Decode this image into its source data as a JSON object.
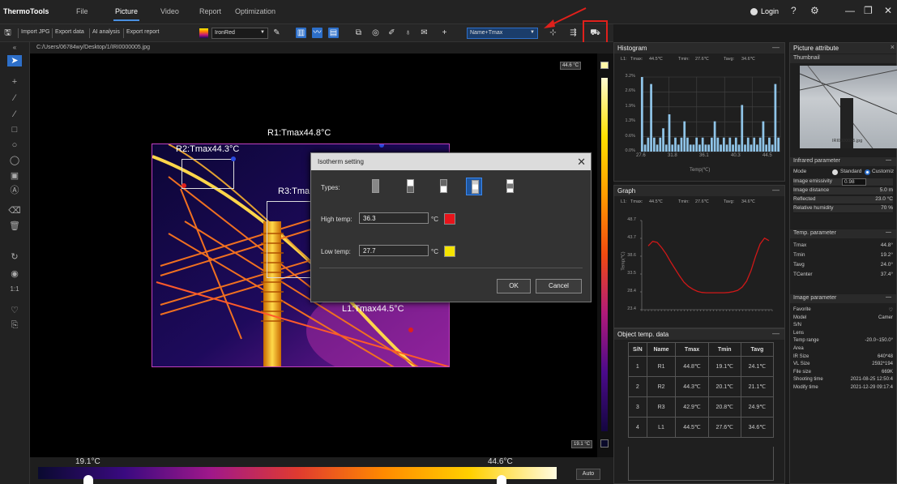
{
  "app": {
    "title": "ThermoTools"
  },
  "menu": {
    "items": [
      "File",
      "Picture",
      "Video",
      "Report",
      "Optimization"
    ],
    "active": "Picture"
  },
  "topright": {
    "login": "Login"
  },
  "toolbar": {
    "import_jpg": "Import JPG",
    "export_data": "Export data",
    "ai_analysis": "AI analysis",
    "export_report": "Export report",
    "palette": "IronRed",
    "label_mode": "Name+Tmax"
  },
  "file_path": "C:/Users/06784wy/Desktop/1/IRI0000005.jpg",
  "image_view": {
    "r1_label": "R1:Tmax44.8°C",
    "r2_label": "R2:Tmax44.3°C",
    "r3_label": "R3:Tma",
    "l1_label": "L1:Tmax44.5°C"
  },
  "scale": {
    "top": "44.6 °C",
    "bottom": "19.1 °C"
  },
  "colorbar": {
    "low": "19.1°C",
    "high": "44.6°C",
    "auto_button": "Auto"
  },
  "histogram": {
    "title": "Histogram",
    "stats": {
      "l1": "L1:",
      "tmax_label": "Tmax:",
      "tmax": "44.5℃",
      "tmin_label": "Tmin:",
      "tmin": "27.6℃",
      "tavg_label": "Tavg:",
      "tavg": "34.6℃"
    },
    "y_ticks": [
      "3.2%",
      "2.6%",
      "1.9%",
      "1.3%",
      "0.6%",
      "0.0%"
    ],
    "x_ticks": [
      "27.6",
      "31.8",
      "36.1",
      "40.3",
      "44.5"
    ],
    "x_label": "Temp(℃)"
  },
  "graph": {
    "title": "Graph",
    "stats": {
      "l1": "L1:",
      "tmax_label": "Tmax:",
      "tmax": "44.5℃",
      "tmin_label": "Tmin:",
      "tmin": "27.6℃",
      "tavg_label": "Tavg:",
      "tavg": "34.6℃"
    },
    "y_ticks": [
      "48.7",
      "43.7",
      "38.6",
      "33.5",
      "28.4",
      "23.4"
    ],
    "y_label": "Temp(℃)"
  },
  "object_data": {
    "title": "Object temp. data",
    "headers": [
      "S/N",
      "Name",
      "Tmax",
      "Tmin",
      "Tavg"
    ],
    "rows": [
      [
        "1",
        "R1",
        "44.8℃",
        "19.1℃",
        "24.1℃"
      ],
      [
        "2",
        "R2",
        "44.3℃",
        "20.1℃",
        "21.1℃"
      ],
      [
        "3",
        "R3",
        "42.9℃",
        "20.8℃",
        "24.9℃"
      ],
      [
        "4",
        "L1",
        "44.5℃",
        "27.6℃",
        "34.6℃"
      ]
    ]
  },
  "picture_attribute": {
    "title": "Picture attribute",
    "thumbnail_label": "Thumbnail",
    "thumbnail_caption": "IRI0000005.jpg"
  },
  "infrared": {
    "title": "Infrared parameter",
    "mode_label": "Mode",
    "mode_standard": "Standard",
    "mode_custom": "Customiz",
    "emissivity_label": "Image emissivity",
    "emissivity": "0.98",
    "distance_label": "Image distance",
    "distance": "5.0 m",
    "reflected_label": "Reflected",
    "reflected": "23.0 °C",
    "humidity_label": "Relative humidity",
    "humidity": "70 %"
  },
  "temp_param": {
    "title": "Temp. parameter",
    "rows": [
      [
        "Tmax",
        "44.8°"
      ],
      [
        "Tmin",
        "19.2°"
      ],
      [
        "Tavg",
        "24.0°"
      ],
      [
        "TCenter",
        "37.4°"
      ]
    ]
  },
  "image_param": {
    "title": "Image parameter",
    "rows": [
      [
        "Favorite",
        ""
      ],
      [
        "Model",
        "Camer"
      ],
      [
        "S/N",
        ""
      ],
      [
        "Lens",
        ""
      ],
      [
        "Temp range",
        "-20.0~150.0°"
      ],
      [
        "Area",
        ""
      ],
      [
        "IR Size",
        "640*48"
      ],
      [
        "VL Size",
        "2592*194"
      ],
      [
        "File size",
        "669K"
      ],
      [
        "Shooting time",
        "2021-08-25 12:50:4"
      ],
      [
        "Modify time",
        "2021-12-29 09:17:4"
      ]
    ]
  },
  "dialog": {
    "title": "Isotherm setting",
    "types_label": "Types:",
    "high_label": "High temp:",
    "high_value": "36.3",
    "high_unit": "°C",
    "high_color": "#e8141b",
    "low_label": "Low temp:",
    "low_value": "27.7",
    "low_unit": "°C",
    "low_color": "#f5e400",
    "ok": "OK",
    "cancel": "Cancel"
  },
  "colors": {
    "accent": "#2d6fc9",
    "highlight": "#e0201b"
  },
  "chart_data": [
    {
      "type": "bar",
      "title": "Histogram",
      "xlabel": "Temp(℃)",
      "ylabel": "",
      "ylim": [
        0,
        3.2
      ],
      "x_ticks": [
        27.6,
        31.8,
        36.1,
        40.3,
        44.5
      ],
      "values": [
        3.2,
        0.3,
        0.6,
        2.9,
        0.6,
        0.3,
        0.6,
        1.0,
        0.3,
        1.6,
        0.3,
        0.6,
        0.3,
        0.6,
        1.3,
        0.6,
        0.3,
        0.3,
        0.6,
        0.3,
        0.6,
        0.3,
        0.3,
        0.6,
        1.3,
        0.6,
        0.3,
        0.6,
        0.3,
        0.6,
        0.3,
        0.6,
        0.3,
        2.0,
        0.3,
        0.6,
        0.3,
        0.6,
        0.3,
        0.6,
        1.3,
        0.3,
        0.6,
        0.3,
        2.9,
        0.6
      ]
    },
    {
      "type": "line",
      "title": "Graph",
      "xlabel": "",
      "ylabel": "Temp(℃)",
      "ylim": [
        23.4,
        48.7
      ],
      "series": [
        {
          "values": [
            41.5,
            42.8,
            42.5,
            41.0,
            39.2,
            37.0,
            35.0,
            33.0,
            31.2,
            30.0,
            29.2,
            28.6,
            28.3,
            28.2,
            28.2,
            28.2,
            28.2,
            28.2,
            28.3,
            28.5,
            28.9,
            29.8,
            31.5,
            34.5,
            38.5,
            42.0,
            43.7,
            43.0
          ]
        }
      ]
    }
  ]
}
